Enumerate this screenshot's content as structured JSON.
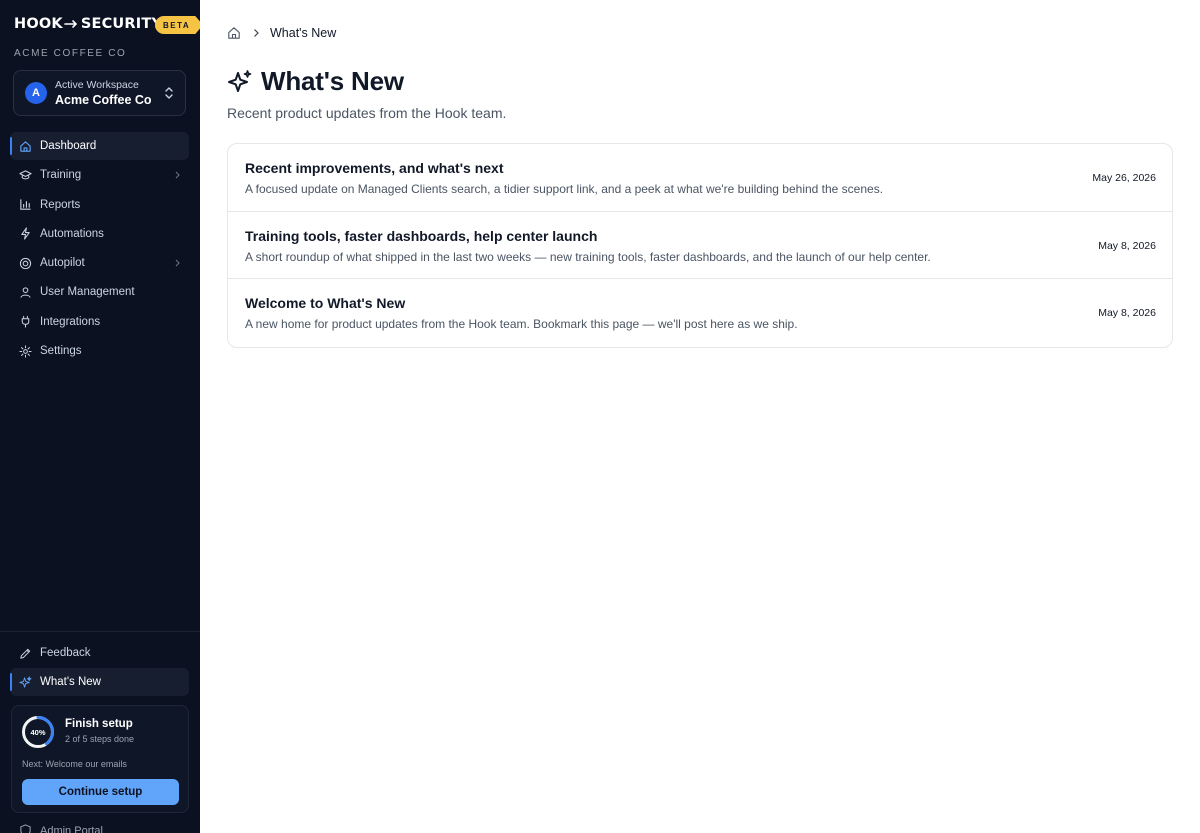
{
  "brand": {
    "name_left": "HOOK",
    "name_right": "SECURITY",
    "badge": "BETA",
    "org": "ACME COFFEE CO"
  },
  "workspace": {
    "avatar_letter": "A",
    "label": "Active Workspace",
    "name": "Acme Coffee Co"
  },
  "nav": {
    "items": [
      {
        "label": "Dashboard",
        "icon": "home-icon",
        "active": true
      },
      {
        "label": "Training",
        "icon": "graduation-cap-icon",
        "has_chevron": true
      },
      {
        "label": "Reports",
        "icon": "bar-chart-icon"
      },
      {
        "label": "Automations",
        "icon": "bolt-icon"
      },
      {
        "label": "Autopilot",
        "icon": "target-icon",
        "has_chevron": true
      },
      {
        "label": "User Management",
        "icon": "user-icon"
      },
      {
        "label": "Integrations",
        "icon": "plug-icon"
      },
      {
        "label": "Settings",
        "icon": "gear-icon"
      }
    ],
    "bottom": [
      {
        "label": "Feedback",
        "icon": "pencil-icon"
      },
      {
        "label": "What's New",
        "icon": "sparkles-icon",
        "active": true
      }
    ]
  },
  "setup": {
    "progress_label": "40%",
    "progress_fraction": 0.4,
    "title": "Finish setup",
    "subtitle": "2 of 5 steps done",
    "next": "Next: Welcome our emails",
    "button": "Continue setup"
  },
  "admin_portal": {
    "label": "Admin Portal"
  },
  "breadcrumb": {
    "current": "What's New"
  },
  "page": {
    "title": "What's New",
    "subtitle": "Recent product updates from the Hook team."
  },
  "updates": [
    {
      "title": "Recent improvements, and what's next",
      "description": "A focused update on Managed Clients search, a tidier support link, and a peek at what we're building behind the scenes.",
      "date": "May 26, 2026"
    },
    {
      "title": "Training tools, faster dashboards, help center launch",
      "description": "A short roundup of what shipped in the last two weeks — new training tools, faster dashboards, and the launch of our help center.",
      "date": "May 8, 2026"
    },
    {
      "title": "Welcome to What's New",
      "description": "A new home for product updates from the Hook team. Bookmark this page — we'll post here as we ship.",
      "date": "May 8, 2026"
    }
  ],
  "colors": {
    "sidebar_bg": "#0b1120",
    "accent": "#3b82f6",
    "button": "#60a5fa",
    "beta_badge": "#f6c344"
  }
}
